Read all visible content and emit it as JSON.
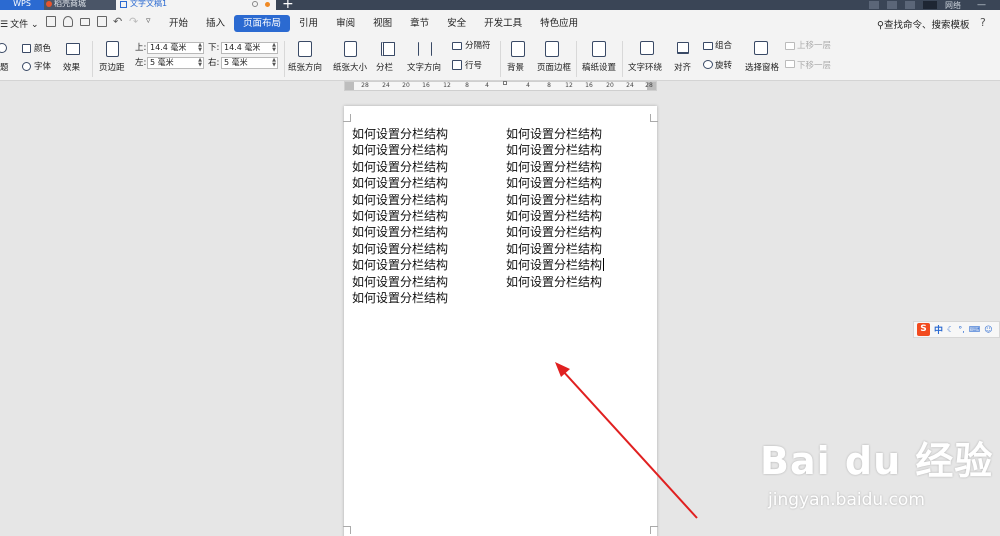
{
  "titlebar": {
    "app_label": "WPS",
    "tab_daoke": "稻壳商城",
    "tab_doc": "文字文稿1",
    "new_tab": "+",
    "user_name": "网络",
    "minimize": "—"
  },
  "menubar": {
    "file_label": "文件",
    "tabs": [
      {
        "label": "开始"
      },
      {
        "label": "插入"
      },
      {
        "label": "页面布局"
      },
      {
        "label": "引用"
      },
      {
        "label": "审阅"
      },
      {
        "label": "视图"
      },
      {
        "label": "章节"
      },
      {
        "label": "安全"
      },
      {
        "label": "开发工具"
      },
      {
        "label": "特色应用"
      }
    ],
    "active_tab": "页面布局",
    "search": "查找命令、搜索模板",
    "help": "?"
  },
  "ribbon": {
    "theme_colors": "颜色",
    "theme_fonts": "字体",
    "theme_effects": "效果",
    "theme_label": "题",
    "margins": "页边距",
    "margin_top_label": "上:",
    "margin_top_value": "14.4 毫米",
    "margin_bottom_label": "下:",
    "margin_bottom_value": "14.4 毫米",
    "margin_left_label": "左:",
    "margin_left_value": "5 毫米",
    "margin_right_label": "右:",
    "margin_right_value": "5 毫米",
    "orientation": "纸张方向",
    "paper_size": "纸张大小",
    "columns": "分栏",
    "text_direction": "文字方向",
    "breaks": "分隔符",
    "line_numbers": "行号",
    "background": "背景",
    "page_border": "页面边框",
    "draft_paper": "稿纸设置",
    "text_wrap": "文字环绕",
    "align": "对齐",
    "group": "组合",
    "rotate": "旋转",
    "selection_pane": "选择窗格",
    "bring_forward": "上移一层",
    "send_backward": "下移一层"
  },
  "ruler": {
    "labels": [
      "28",
      "24",
      "20",
      "16",
      "12",
      "8",
      "4",
      "",
      "4",
      "8",
      "12",
      "16",
      "20",
      "24",
      "28"
    ]
  },
  "document": {
    "column1": [
      "如何设置分栏结构",
      "如何设置分栏结构",
      "如何设置分栏结构",
      "如何设置分栏结构",
      "如何设置分栏结构",
      "如何设置分栏结构",
      "如何设置分栏结构",
      "如何设置分栏结构",
      "如何设置分栏结构",
      "如何设置分栏结构",
      "如何设置分栏结构"
    ],
    "column2": [
      "如何设置分栏结构",
      "如何设置分栏结构",
      "如何设置分栏结构",
      "如何设置分栏结构",
      "如何设置分栏结构",
      "如何设置分栏结构",
      "如何设置分栏结构",
      "如何设置分栏结构",
      "如何设置分栏结构",
      "如何设置分栏结构"
    ]
  },
  "ime": {
    "logo": "S",
    "mode": "中"
  },
  "watermark": {
    "brand": "Bai du 经验",
    "url": "jingyan.baidu.com"
  },
  "colors": {
    "accent": "#2b6ad1",
    "arrow": "#e02020",
    "titlebar": "#3a4556"
  }
}
